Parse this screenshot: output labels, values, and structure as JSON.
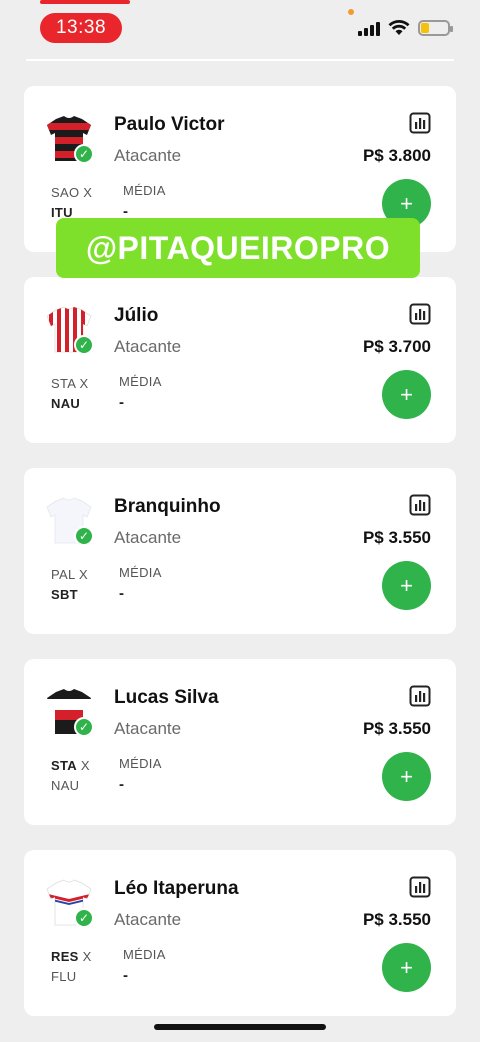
{
  "status": {
    "time": "13:38",
    "icons": [
      "signal-icon",
      "wifi-icon",
      "battery-icon"
    ]
  },
  "watermark": "@PITAQUEIROPRO",
  "players": [
    {
      "name": "Paulo Victor",
      "position": "Atacante",
      "price": "P$ 3.800",
      "home": "SAO",
      "vs": "X",
      "away": "ITU",
      "bold": "away",
      "media_label": "MÉDIA",
      "media_value": "-",
      "jersey": "red-black-stripes"
    },
    {
      "name": "Júlio",
      "position": "Atacante",
      "price": "P$ 3.700",
      "home": "STA",
      "vs": "X",
      "away": "NAU",
      "bold": "away",
      "media_label": "MÉDIA",
      "media_value": "-",
      "jersey": "red-white-stripes"
    },
    {
      "name": "Branquinho",
      "position": "Atacante",
      "price": "P$ 3.550",
      "home": "PAL",
      "vs": "X",
      "away": "SBT",
      "bold": "away",
      "media_label": "MÉDIA",
      "media_value": "-",
      "jersey": "plain-white"
    },
    {
      "name": "Lucas Silva",
      "position": "Atacante",
      "price": "P$ 3.550",
      "home": "STA",
      "vs": "X",
      "away": "NAU",
      "bold": "home",
      "media_label": "MÉDIA",
      "media_value": "-",
      "jersey": "red-black-band"
    },
    {
      "name": "Léo Itaperuna",
      "position": "Atacante",
      "price": "P$ 3.550",
      "home": "RES",
      "vs": "X",
      "away": "FLU",
      "bold": "home",
      "media_label": "MÉDIA",
      "media_value": "-",
      "jersey": "white-red-blue"
    }
  ],
  "colors": {
    "accent_green": "#2fb34a",
    "watermark_green": "#7ee02a",
    "time_red": "#e8262b"
  }
}
